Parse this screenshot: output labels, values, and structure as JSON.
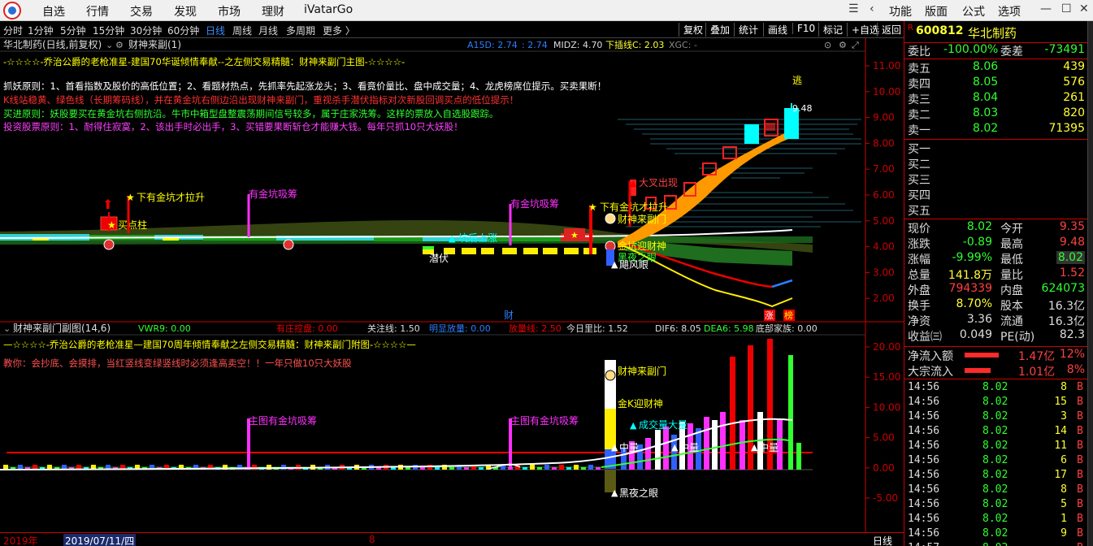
{
  "menubar": {
    "items": [
      "自选",
      "行情",
      "交易",
      "发现",
      "市场",
      "理财",
      "iVatarGo"
    ],
    "right_items": [
      "功能",
      "版面",
      "公式",
      "选项"
    ]
  },
  "toolbar": {
    "periods": [
      "分时",
      "1分钟",
      "5分钟",
      "15分钟",
      "30分钟",
      "60分钟",
      "日线",
      "周线",
      "月线",
      "多周期",
      "更多 〉"
    ],
    "active_period": "日线",
    "buttons": [
      "复权",
      "叠加",
      "统计",
      "画线",
      "F10",
      "标记",
      "+自选",
      "返回"
    ]
  },
  "main_chart": {
    "title": "华北制药(日线,前复权)",
    "indicator": "财神来副(1)",
    "header_a15d": "A15D: 2.74",
    "header_a15d_b": ": 2.74",
    "header_midz": "MIDZ: 4.70",
    "header_xia": "下插线C: 2.03",
    "header_xgc": "XGC: -",
    "text_lines": [
      "-☆☆☆☆-乔治公爵的老枪准星-建国70华诞倾情奉献--之左侧交易精髓：财神来副门主图-☆☆☆☆-",
      "抓妖原则：1、首看指数及股价的高低位置；2、看题材热点，先抓率先起涨龙头；3、看竟价量比、盘中成交量；4、龙虎榜席位提示。买卖果断！",
      "K线站稳黄、绿色线（长期筹码线），并在黄金坑右侧边沿出现财神来副门，重视杀手潜伏指标对次新股回调买点的低位提示！",
      "买进原则：妖股要买在黄金坑右侧抗沿。牛市中箱型盘整震荡期间信号较多，属于庄家洗筹。这样的票放入自选股跟踪。",
      "投资股票原则：1、耐得住寂寞，2、该出手时必出手，3、买错要果断斩仓才能赚大钱。每年只抓10只大妖股！"
    ],
    "y_ticks": [
      "11.00",
      "10.00",
      "9.00",
      "8.00",
      "7.00",
      "6.00",
      "5.00",
      "4.00",
      "3.00",
      "2.00"
    ],
    "annotations": {
      "buy_point": "买点柱",
      "gold_pit_1": "下有金坑才拉升",
      "gold_pit_2": "有金坑吸筹",
      "gold_pit_3": "有金坑吸筹",
      "gold_pit_4": "下有金坑才拉升",
      "open_up": "坑后上涨",
      "lurk": "潜伏",
      "caishen": "财神来副门",
      "big_cross": "大叉出现",
      "gold_k": "金坑迎财神",
      "dark_night": "黑夜之眼",
      "storm_eye": "飓风眼",
      "escape": "逃",
      "high_price": "9.48",
      "rise_1": "涨",
      "rise_2": "榜",
      "cai": "财"
    }
  },
  "sub_chart": {
    "title": "财神来副门副图(14,6)",
    "vwr9": "VWR9: 0.00",
    "zhuang": "有庄控盘: 0.00",
    "guanzhu": "关注线: 1.50",
    "mingxian": "明显放量: 0.00",
    "fangliang": "放量线: 2.50",
    "liangbi": "今日里比: 1.52",
    "dif6": "DIF6: 8.05",
    "dea6": "DEA6: 5.98",
    "dibu": "底部家族: 0.00",
    "text_1": "—☆☆☆☆-乔治公爵的老枪准星—建国70周年倾情奉献之左侧交易精髓：财神来副门附图-☆☆☆☆—",
    "text_2": "教你：会抄底、会摸排，当红竖线变绿竖线时必须逢高卖空！！一年只做10只大妖股",
    "y_ticks": [
      "20.00",
      "15.00",
      "10.00",
      "5.00",
      "0.00",
      "-5.00"
    ],
    "annotations": {
      "main_gold_1": "主图有金坑吸筹",
      "main_gold_2": "主图有金坑吸筹",
      "caishen": "财神来副门",
      "gold_k": "金K迎财神",
      "deal_big": "成交量大量",
      "zhong_1": "中量",
      "zhong_2": "中量",
      "zhong_3": "中量",
      "dark_night": "黑夜之眼"
    }
  },
  "bottombar": {
    "year": "2019年",
    "date": "2019/07/11/四",
    "mark": "8",
    "period": "日线"
  },
  "rpanel": {
    "code": "600812",
    "name": "华北制药",
    "weibi_label": "委比",
    "weibi": "-100.00%",
    "weicha_label": "委差",
    "weicha": "-73491",
    "sells": [
      {
        "label": "卖五",
        "price": "8.06",
        "vol": "439"
      },
      {
        "label": "卖四",
        "price": "8.05",
        "vol": "576"
      },
      {
        "label": "卖三",
        "price": "8.04",
        "vol": "261"
      },
      {
        "label": "卖二",
        "price": "8.03",
        "vol": "820"
      },
      {
        "label": "卖一",
        "price": "8.02",
        "vol": "71395"
      }
    ],
    "buys": [
      "买一",
      "买二",
      "买三",
      "买四",
      "买五"
    ],
    "stats": [
      {
        "l1": "现价",
        "v1": "8.02",
        "l2": "今开",
        "v2": "9.35"
      },
      {
        "l1": "涨跌",
        "v1": "-0.89",
        "l2": "最高",
        "v2": "9.48"
      },
      {
        "l1": "涨幅",
        "v1": "-9.99%",
        "l2": "最低",
        "v2": "8.02"
      },
      {
        "l1": "总量",
        "v1": "141.8万",
        "l2": "量比",
        "v2": "1.52"
      },
      {
        "l1": "外盘",
        "v1": "794339",
        "l2": "内盘",
        "v2": "624073"
      },
      {
        "l1": "换手",
        "v1": "8.70%",
        "l2": "股本",
        "v2": "16.3亿"
      },
      {
        "l1": "净资",
        "v1": "3.36",
        "l2": "流通",
        "v2": "16.3亿"
      },
      {
        "l1": "收益㈢",
        "v1": "0.049",
        "l2": "PE(动)",
        "v2": "82.3"
      }
    ],
    "flow": [
      {
        "label": "净流入额",
        "value": "1.47亿",
        "pct": "12%"
      },
      {
        "label": "大宗流入",
        "value": "1.01亿",
        "pct": "8%"
      }
    ],
    "ticks": [
      {
        "time": "14:56",
        "price": "8.02",
        "vol": "8",
        "side": "B"
      },
      {
        "time": "14:56",
        "price": "8.02",
        "vol": "15",
        "side": "B"
      },
      {
        "time": "14:56",
        "price": "8.02",
        "vol": "3",
        "side": "B"
      },
      {
        "time": "14:56",
        "price": "8.02",
        "vol": "14",
        "side": "B"
      },
      {
        "time": "14:56",
        "price": "8.02",
        "vol": "11",
        "side": "B"
      },
      {
        "time": "14:56",
        "price": "8.02",
        "vol": "6",
        "side": "B"
      },
      {
        "time": "14:56",
        "price": "8.02",
        "vol": "17",
        "side": "B"
      },
      {
        "time": "14:56",
        "price": "8.02",
        "vol": "8",
        "side": "B"
      },
      {
        "time": "14:56",
        "price": "8.02",
        "vol": "5",
        "side": "B"
      },
      {
        "time": "14:56",
        "price": "8.02",
        "vol": "1",
        "side": "B"
      },
      {
        "time": "14:56",
        "price": "8.02",
        "vol": "9",
        "side": "B"
      },
      {
        "time": "14:57",
        "price": "8.02",
        "vol": "",
        "side": "B"
      }
    ]
  }
}
